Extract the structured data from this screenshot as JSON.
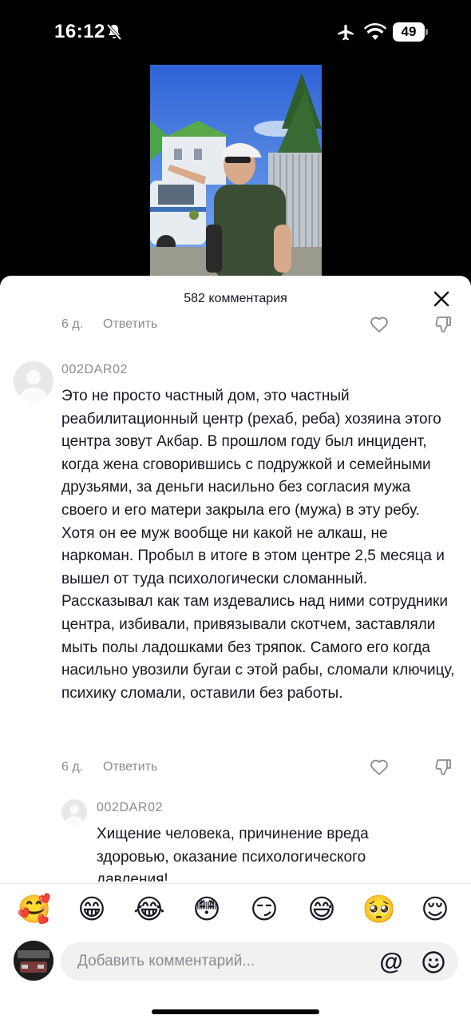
{
  "status_bar": {
    "time": "16:12",
    "battery": "49",
    "icons": [
      "mute-icon",
      "airplane-icon",
      "wifi-icon",
      "battery-icon"
    ]
  },
  "video": {
    "description_icon": "video-thumbnail"
  },
  "sheet": {
    "title": "582 комментария",
    "close_icon": "close-icon"
  },
  "comments": [
    {
      "date": "6 д.",
      "reply": "Ответить",
      "partial": true
    },
    {
      "username": "002DAR02",
      "text": "Это не просто частный дом, это частный реабилитационный центр (рехаб, реба) хозяина этого центра зовут Акбар. В прошлом году был инцидент, когда жена сговорившись с подружкой и семейными друзьями, за деньги насильно без согласия мужа своего и его матери закрыла его (мужа) в эту ребу. Хотя он ее муж вообще ни какой не алкаш, не наркоман. Пробыл в итоге в этом центре 2,5 месяца и вышел от туда психологически сломанный. Рассказывал как там издевались над ними сотрудники центра, избивали, привязывали скотчем, заставляли мыть полы ладошками без тряпок. Самого его когда насильно увозили бугаи с этой рабы, сломали ключицу, психику сломали, оставили без работы.",
      "date": "6 д.",
      "reply": "Ответить"
    },
    {
      "username": "002DAR02",
      "text": "Хищение человека, причинение вреда здоровью, оказание психологического давления!",
      "is_reply": true
    }
  ],
  "emoji_bar": [
    "🥰",
    "😁",
    "😂",
    "😳",
    "😏",
    "😅",
    "🥺",
    "😌"
  ],
  "compose": {
    "placeholder": "Добавить комментарий...",
    "mention": "@",
    "emoji_icon": "smiley-icon"
  }
}
